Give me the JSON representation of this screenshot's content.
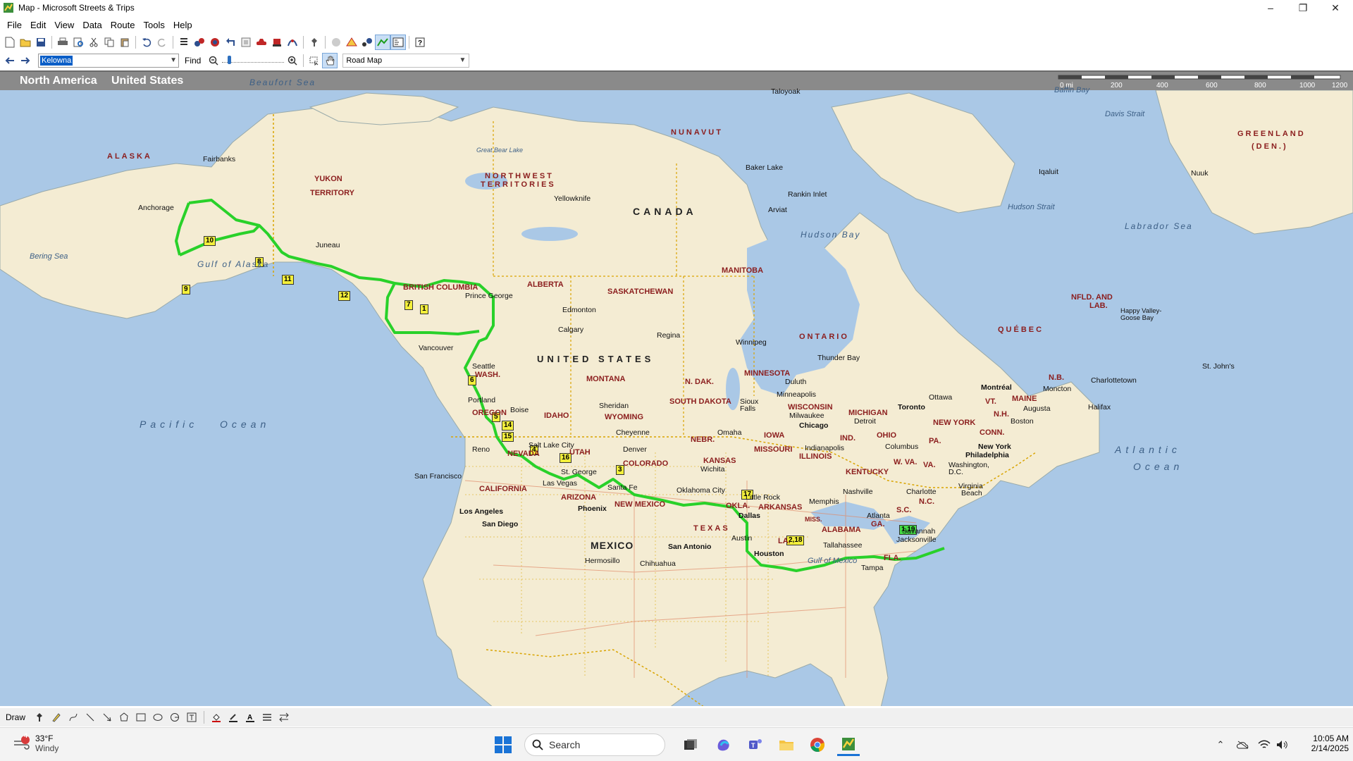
{
  "window": {
    "title": "Map - Microsoft Streets & Trips"
  },
  "menu": [
    {
      "label": "File"
    },
    {
      "label": "Edit"
    },
    {
      "label": "View"
    },
    {
      "label": "Data"
    },
    {
      "label": "Route"
    },
    {
      "label": "Tools"
    },
    {
      "label": "Help"
    }
  ],
  "toolbar2": {
    "find_value": "Kelowna",
    "find_label": "Find",
    "map_type": "Road Map"
  },
  "map": {
    "region": "North America",
    "country": "United States",
    "scale_labels": [
      "0 mi",
      "200",
      "400",
      "600",
      "800",
      "1000",
      "1200"
    ],
    "colors": {
      "water": "#aac8e6",
      "land": "#f4ecd3",
      "route": "#29d12a",
      "border": "#d9a400"
    }
  },
  "labels": {
    "beaufort": "Beaufort Sea",
    "alaska": "ALASKA",
    "fairbanks": "Fairbanks",
    "anchorage": "Anchorage",
    "bering": "Bering Sea",
    "gulf_alaska": "Gulf of Alaska",
    "juneau": "Juneau",
    "yukon": "YUKON",
    "territory": "TERRITORY",
    "nwt1": "NORTHWEST",
    "nwt2": "TERRITORIES",
    "great_bear": "Great Bear Lake",
    "yellowknife": "Yellowknife",
    "nunavut": "NUNAVUT",
    "taloyoak": "Taloyoak",
    "baker": "Baker Lake",
    "rankin": "Rankin Inlet",
    "arviat": "Arviat",
    "canada": "CANADA",
    "hudson_bay": "Hudson Bay",
    "hudson_strait": "Hudson Strait",
    "baffin": "Baffin Bay",
    "davis": "Davis Strait",
    "iqaluit": "Iqaluit",
    "nuuk": "Nuuk",
    "greenland1": "GREENLAND",
    "greenland2": "(DEN.)",
    "labrador": "Labrador Sea",
    "bc": "BRITISH COLUMBIA",
    "prince_george": "Prince George",
    "alberta": "ALBERTA",
    "edmonton": "Edmonton",
    "calgary": "Calgary",
    "sask": "SASKATCHEWAN",
    "regina": "Regina",
    "manitoba": "MANITOBA",
    "winnipeg": "Winnipeg",
    "ontario": "ONTARIO",
    "thunder_bay": "Thunder Bay",
    "quebec": "QUÉBEC",
    "nfld1": "NFLD. AND",
    "nfld2": "LAB.",
    "happy1": "Happy Valley-",
    "happy2": "Goose Bay",
    "stjohns": "St. John's",
    "nb": "N.B.",
    "moncton": "Moncton",
    "charlottetown": "Charlottetown",
    "halifax": "Halifax",
    "vancouver": "Vancouver",
    "seattle": "Seattle",
    "wash": "WASH.",
    "portland": "Portland",
    "oregon": "OREGON",
    "boise": "Boise",
    "idaho": "IDAHO",
    "montana": "MONTANA",
    "usa": "UNITED STATES",
    "ndak": "N. DAK.",
    "sdak": "SOUTH DAKOTA",
    "sheridan": "Sheridan",
    "wyoming": "WYOMING",
    "minnesota": "MINNESOTA",
    "duluth": "Duluth",
    "minneapolis": "Minneapolis",
    "wisconsin": "WISCONSIN",
    "milwaukee": "Milwaukee",
    "michigan": "MICHIGAN",
    "sioux1": "Sioux",
    "sioux2": "Falls",
    "iowa": "IOWA",
    "omaha": "Omaha",
    "nebr": "NEBR.",
    "chicago": "Chicago",
    "detroit": "Detroit",
    "toronto": "Toronto",
    "ottawa": "Ottawa",
    "montreal": "Montréal",
    "vt": "VT.",
    "maine": "MAINE",
    "augusta": "Augusta",
    "nh": "N.H.",
    "boston": "Boston",
    "conn": "CONN.",
    "newyork": "NEW YORK",
    "nyc": "New York",
    "pa": "PA.",
    "philadelphia": "Philadelphia",
    "ohio": "OHIO",
    "columbus": "Columbus",
    "ind": "IND.",
    "indianapolis": "Indianapolis",
    "illinois": "ILLINOIS",
    "missouri": "MISSOURI",
    "wva": "W. VA.",
    "va": "VA.",
    "washington": "Washington,",
    "dc": "D.C.",
    "kentucky": "KENTUCKY",
    "nashville": "Nashville",
    "virginia_beach1": "Virginia",
    "virginia_beach2": "Beach",
    "charlotte": "Charlotte",
    "nc": "N.C.",
    "sc": "S.C.",
    "atlanta": "Atlanta",
    "ga": "GA.",
    "savannah": "Savannah",
    "jacksonville": "Jacksonville",
    "fla": "FLA.",
    "tampa": "Tampa",
    "tallahassee": "Tallahassee",
    "alabama": "ALABAMA",
    "memphis": "Memphis",
    "miss": "MISS.",
    "la": "LA.",
    "houston": "Houston",
    "san_antonio": "San Antonio",
    "austin": "Austin",
    "dallas": "Dallas",
    "texas": "TEXAS",
    "okla": "OKLA.",
    "oklahoma_city": "Oklahoma City",
    "arkansas": "ARKANSAS",
    "little_rock": "Little Rock",
    "kansas": "KANSAS",
    "wichita": "Wichita",
    "colorado": "COLORADO",
    "denver": "Denver",
    "cheyenne": "Cheyenne",
    "utah": "UTAH",
    "slc": "Salt Lake City",
    "nevada": "NEVADA",
    "reno": "Reno",
    "sf": "San Francisco",
    "california": "CALIFORNIA",
    "las_vegas": "Las Vegas",
    "st_george": "St. George",
    "arizona": "ARIZONA",
    "phoenix": "Phoenix",
    "new_mexico": "NEW MEXICO",
    "santa_fe": "Santa Fe",
    "la_city": "Los Angeles",
    "san_diego": "San Diego",
    "mexico": "MEXICO",
    "hermosillo": "Hermosillo",
    "chihuahua": "Chihuahua",
    "gulf_mexico": "Gulf of Mexico",
    "pacific1": "Pacific",
    "pacific2": "Ocean",
    "atlantic1": "Atlantic",
    "atlantic2": "Ocean"
  },
  "stops": [
    {
      "label": "10"
    },
    {
      "label": "8"
    },
    {
      "label": "9"
    },
    {
      "label": "11"
    },
    {
      "label": "12"
    },
    {
      "label": "7"
    },
    {
      "label": "1"
    },
    {
      "label": "6"
    },
    {
      "label": "5"
    },
    {
      "label": "14"
    },
    {
      "label": "15"
    },
    {
      "label": "4"
    },
    {
      "label": "16"
    },
    {
      "label": "3"
    },
    {
      "label": "17"
    },
    {
      "label": "2,18"
    },
    {
      "label": "1,19"
    }
  ],
  "drawbar": {
    "label": "Draw"
  },
  "taskbar": {
    "weather_temp": "33°F",
    "weather_desc": "Windy",
    "weather_badge": "4",
    "search_placeholder": "Search",
    "time": "10:05 AM",
    "date": "2/14/2025"
  }
}
